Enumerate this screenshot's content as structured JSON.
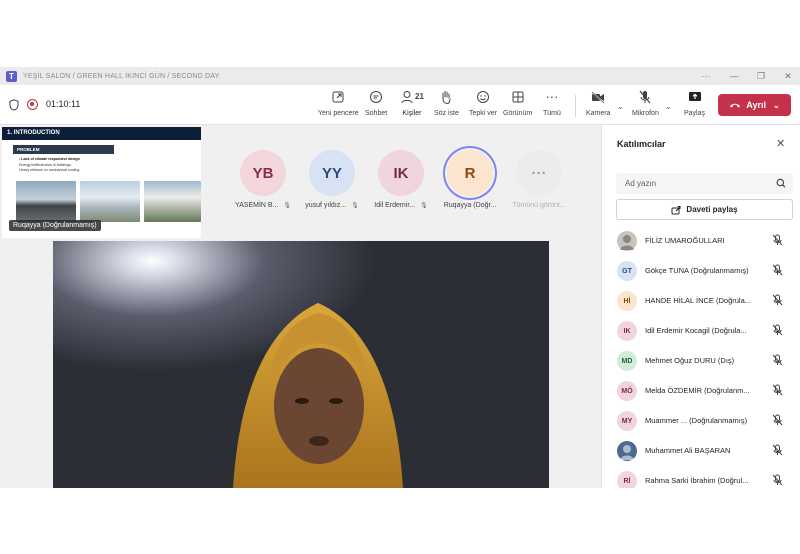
{
  "window": {
    "title": "YEŞİL SALON / GREEN HALL İKİNCİ GÜN / SECOND DAY",
    "controls": [
      "···",
      "—",
      "❐",
      "✕"
    ]
  },
  "toolbar": {
    "timer": "01:10:11",
    "items": [
      {
        "label": "Yeni pencere",
        "icon": "new-window-icon"
      },
      {
        "label": "Sohbet",
        "icon": "chat-icon"
      },
      {
        "label": "Kişiler",
        "icon": "people-icon",
        "count": "21",
        "active": true
      },
      {
        "label": "Söz iste",
        "icon": "raise-hand-icon"
      },
      {
        "label": "Tepki ver",
        "icon": "react-icon"
      },
      {
        "label": "Görünüm",
        "icon": "view-icon"
      },
      {
        "label": "Tümü",
        "icon": "more-icon"
      }
    ],
    "camera_label": "Kamera",
    "mic_label": "Mikrofon",
    "share_label": "Paylaş",
    "leave_label": "Ayrıl",
    "leave_color": "#c4314b",
    "accent": "#5b5fc7"
  },
  "stage": {
    "slide": {
      "heading": "1. INTRODUCTION",
      "section": "PROBLEM",
      "bullets": [
        "• Lack of climate responsive design",
        "Energy inefficiencies in buildings",
        "Heavy reliance on mechanical cooling"
      ],
      "presenter": "Ruqayya (Doğrulanmamış)"
    },
    "gallery": [
      {
        "initials": "YB",
        "name": "YASEMİN B...",
        "bg": "#f3d6dc",
        "fg": "#8a2d44",
        "muted": true
      },
      {
        "initials": "YY",
        "name": "yusuf yıldız...",
        "bg": "#d7e3f4",
        "fg": "#2a4a78",
        "muted": true
      },
      {
        "initials": "IK",
        "name": "Idil Erdemir...",
        "bg": "#f0d5df",
        "fg": "#7a2846",
        "muted": true
      },
      {
        "initials": "R",
        "name": "Ruqayya (Doğr...",
        "bg": "#fbe5cf",
        "fg": "#8a4a12",
        "muted": false,
        "speaking": true
      },
      {
        "initials": "···",
        "name": "Tümünü görünt...",
        "bg": "#ececec",
        "fg": "#a0a0a0",
        "muted": false
      }
    ]
  },
  "panel": {
    "title": "Katılımcılar",
    "search_placeholder": "Ad yazın",
    "share_invite": "Daveti paylaş",
    "participants": [
      {
        "initials": "",
        "name": "FİLİZ UMAROĞULLARI",
        "bg": "#c9c3bb",
        "fg": "#555",
        "photo": true
      },
      {
        "initials": "GT",
        "name": "Gökçe TUNA (Doğrulanmamış)",
        "bg": "#d7e3f4",
        "fg": "#2a4a78"
      },
      {
        "initials": "Hİ",
        "name": "HANDE HİLAL İNCE (Doğrula...",
        "bg": "#fbe5cf",
        "fg": "#8a4a12"
      },
      {
        "initials": "IK",
        "name": "Idil Erdemir Kocagil (Doğrula...",
        "bg": "#f0d5df",
        "fg": "#7a2846"
      },
      {
        "initials": "MD",
        "name": "Mehmet Oğuz DURU (Dış)",
        "bg": "#d3ecd9",
        "fg": "#1f6b35"
      },
      {
        "initials": "MÖ",
        "name": "Melda ÖZDEMİR (Doğrulanm...",
        "bg": "#f0d5df",
        "fg": "#7a2846"
      },
      {
        "initials": "MY",
        "name": "Muammer ... (Doğrulanmamış)",
        "bg": "#f0d5df",
        "fg": "#7a2846"
      },
      {
        "initials": "",
        "name": "Muhammet Ali BAŞARAN",
        "bg": "#4a6b8f",
        "fg": "#fff",
        "photo": true
      },
      {
        "initials": "Rİ",
        "name": "Rahma Sarki İbrahim (Doğrul...",
        "bg": "#f3d6dc",
        "fg": "#8a2d44"
      }
    ]
  }
}
